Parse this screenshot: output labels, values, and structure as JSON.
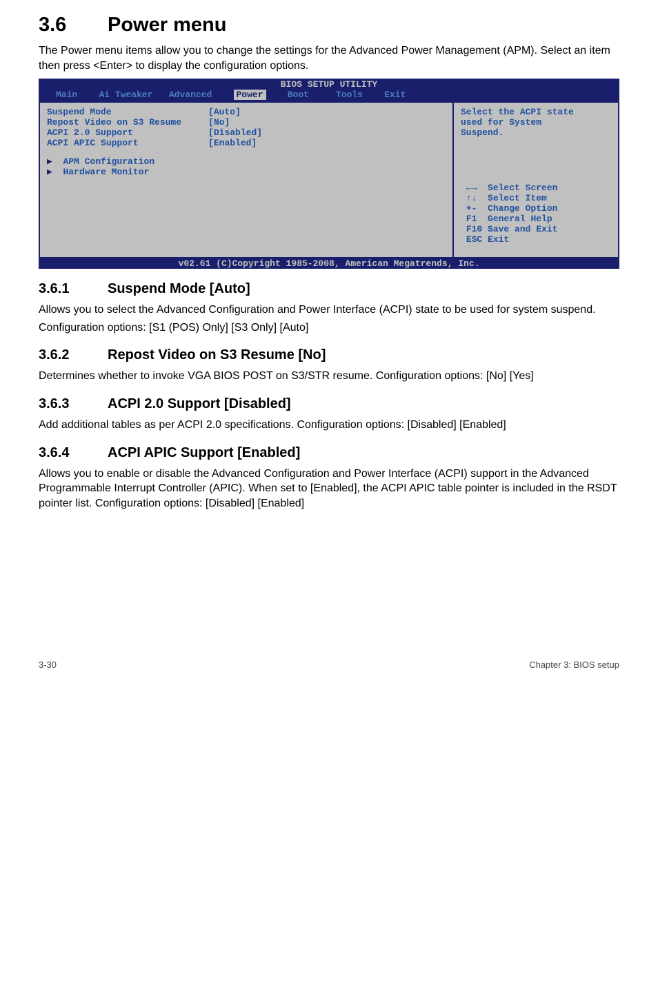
{
  "heading": {
    "num": "3.6",
    "title": "Power menu"
  },
  "intro": "The Power menu items allow you to change the settings for the Advanced Power Management (APM). Select an item then press <Enter> to display the configuration options.",
  "bios": {
    "title": "BIOS SETUP UTILITY",
    "menu": [
      "Main",
      "Ai Tweaker",
      "Advanced",
      "Power",
      "Boot",
      "Tools",
      "Exit"
    ],
    "selected_menu": "Power",
    "options": [
      {
        "label": "Suspend Mode",
        "value": "[Auto]"
      },
      {
        "label": "Repost Video on S3 Resume",
        "value": "[No]"
      },
      {
        "label": "ACPI 2.0 Support",
        "value": "[Disabled]"
      },
      {
        "label": "ACPI APIC Support",
        "value": "[Enabled]"
      }
    ],
    "submenus": [
      "APM Configuration",
      "Hardware Monitor"
    ],
    "help": [
      "Select the ACPI state",
      "used for System",
      "Suspend."
    ],
    "keys": [
      {
        "k": "←→",
        "t": "Select Screen"
      },
      {
        "k": "↑↓",
        "t": "Select Item"
      },
      {
        "k": "+-",
        "t": " Change Option"
      },
      {
        "k": "F1",
        "t": " General Help"
      },
      {
        "k": "F10",
        "t": "Save and Exit"
      },
      {
        "k": "ESC",
        "t": "Exit"
      }
    ],
    "footer": "v02.61 (C)Copyright 1985-2008, American Megatrends, Inc."
  },
  "sections": [
    {
      "num": "3.6.1",
      "title": "Suspend Mode [Auto]",
      "paras": [
        "Allows you to select the Advanced Configuration and Power Interface (ACPI) state to be used for system suspend.",
        "Configuration options: [S1 (POS) Only] [S3 Only] [Auto]"
      ]
    },
    {
      "num": "3.6.2",
      "title": "Repost Video on S3 Resume [No]",
      "paras": [
        "Determines whether to invoke VGA BIOS POST on S3/STR resume. Configuration options: [No] [Yes]"
      ]
    },
    {
      "num": "3.6.3",
      "title": "ACPI 2.0 Support [Disabled]",
      "paras": [
        "Add additional tables as per ACPI 2.0 specifications. Configuration options: [Disabled] [Enabled]"
      ]
    },
    {
      "num": "3.6.4",
      "title": "ACPI APIC Support [Enabled]",
      "paras": [
        "Allows you to enable or disable the Advanced Configuration and Power Interface (ACPI) support in the Advanced Programmable Interrupt Controller (APIC). When set to [Enabled], the ACPI APIC table pointer is included in the RSDT pointer list. Configuration options: [Disabled] [Enabled]"
      ]
    }
  ],
  "footer": {
    "left": "3-30",
    "right": "Chapter 3: BIOS setup"
  }
}
